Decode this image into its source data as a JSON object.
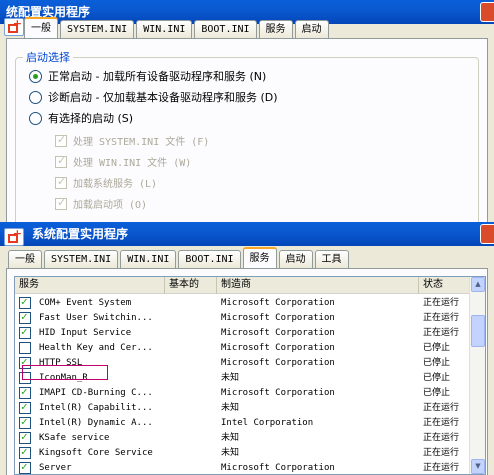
{
  "top_window": {
    "title": "统配置实用程序",
    "tabs": [
      "一般",
      "SYSTEM.INI",
      "WIN.INI",
      "BOOT.INI",
      "服务",
      "启动"
    ],
    "selected_tab": "一般",
    "startup_group_label": "启动选择",
    "options": [
      {
        "label": "正常启动 - 加载所有设备驱动程序和服务 (N)",
        "selected": true
      },
      {
        "label": "诊断启动 - 仅加载基本设备驱动程序和服务 (D)",
        "selected": false
      },
      {
        "label": "有选择的启动 (S)",
        "selected": false
      }
    ],
    "selective_items": [
      {
        "label": "处理 SYSTEM.INI 文件 (F)",
        "checked": true
      },
      {
        "label": "处理 WIN.INI 文件 (W)",
        "checked": true
      },
      {
        "label": "加载系统服务 (L)",
        "checked": true
      },
      {
        "label": "加载启动项 (O)",
        "checked": true
      }
    ]
  },
  "bottom_window": {
    "title": "系统配置实用程序",
    "tabs": [
      "一般",
      "SYSTEM.INI",
      "WIN.INI",
      "BOOT.INI",
      "服务",
      "启动",
      "工具"
    ],
    "selected_tab": "服务",
    "columns": [
      "服务",
      "基本的",
      "制造商",
      "状态"
    ],
    "rows": [
      {
        "checked": true,
        "service": "COM+ Event System",
        "maker": "Microsoft Corporation",
        "status": "正在运行"
      },
      {
        "checked": true,
        "service": "Fast User Switchin...",
        "maker": "Microsoft Corporation",
        "status": "正在运行"
      },
      {
        "checked": true,
        "service": "HID Input Service",
        "maker": "Microsoft Corporation",
        "status": "正在运行"
      },
      {
        "checked": false,
        "service": "Health Key and Cer...",
        "maker": "Microsoft Corporation",
        "status": "已停止"
      },
      {
        "checked": true,
        "service": "HTTP SSL",
        "maker": "Microsoft Corporation",
        "status": "已停止"
      },
      {
        "checked": false,
        "service": "IconMan_R",
        "maker": "未知",
        "status": "已停止"
      },
      {
        "checked": true,
        "service": "IMAPI CD-Burning C...",
        "maker": "Microsoft Corporation",
        "status": "已停止"
      },
      {
        "checked": true,
        "service": "Intel(R) Capabilit...",
        "maker": "未知",
        "status": "正在运行"
      },
      {
        "checked": true,
        "service": "Intel(R) Dynamic A...",
        "maker": "Intel Corporation",
        "status": "正在运行"
      },
      {
        "checked": true,
        "service": "KSafe service",
        "maker": "未知",
        "status": "正在运行"
      },
      {
        "checked": true,
        "service": "Kingsoft Core Service",
        "maker": "未知",
        "status": "正在运行"
      },
      {
        "checked": true,
        "service": "Server",
        "maker": "Microsoft Corporation",
        "status": "正在运行"
      }
    ],
    "highlighted_row": "IconMan_R"
  },
  "icons": {
    "app": "msconfig-app-icon",
    "scroll_up": "scroll-up-arrow-icon",
    "scroll_down": "scroll-down-arrow-icon"
  },
  "colors": {
    "titlebar": "#0a5fd8",
    "accent": "#0046d5",
    "highlight_box": "#c2006d",
    "check": "#21a121"
  }
}
